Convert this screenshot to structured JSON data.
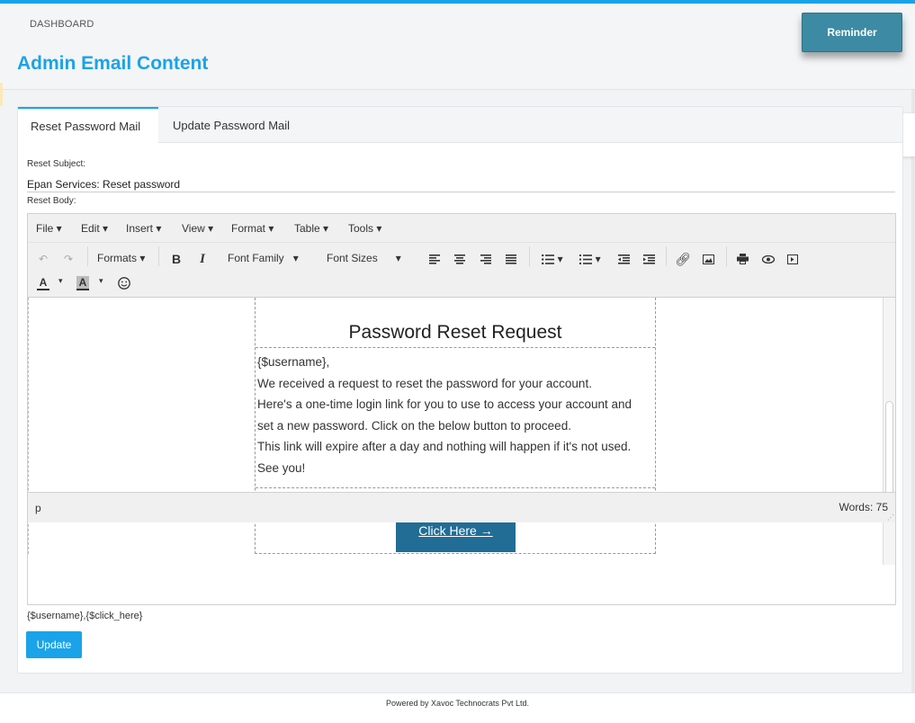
{
  "header": {
    "breadcrumb": "DASHBOARD",
    "title": "Admin Email Content",
    "reminder_label": "Reminder"
  },
  "tabs": [
    {
      "label": "Reset Password Mail",
      "active": true
    },
    {
      "label": "Update Password Mail",
      "active": false
    }
  ],
  "form": {
    "subject_label": "Reset Subject:",
    "subject_value": "Epan Services: Reset password",
    "body_label": "Reset Body:"
  },
  "editor": {
    "menu": [
      "File",
      "Edit",
      "Insert",
      "View",
      "Format",
      "Table",
      "Tools"
    ],
    "toolbar": {
      "formats": "Formats",
      "font_family": "Font Family",
      "font_sizes": "Font Sizes"
    },
    "status_path": "p",
    "word_count": "Words: 75"
  },
  "email": {
    "title": "Password Reset Request",
    "lines": [
      "{$username},",
      "We received a request to reset the password for your account.",
      "Here's a one-time login link for you to use to access your account and",
      "set a new password. Click on the below button to proceed.",
      "This link will expire after a day and nothing will happen if it's not used.",
      "See you!"
    ],
    "button_label": "Click Here →"
  },
  "placeholders": "{$username},{$click_here}",
  "update_label": "Update",
  "footer": "Powered by Xavoc Technocrats Pvt Ltd.",
  "colors": {
    "accent": "#1aa3e8",
    "reminder": "#3c8aa3",
    "email_button": "#216d96"
  },
  "icons": [
    "gear-icon",
    "undo-icon",
    "redo-icon",
    "bold-icon",
    "italic-icon",
    "align-left-icon",
    "align-center-icon",
    "align-right-icon",
    "align-justify-icon",
    "bullet-list-icon",
    "numbered-list-icon",
    "outdent-icon",
    "indent-icon",
    "link-icon",
    "image-icon",
    "print-icon",
    "preview-icon",
    "media-icon",
    "text-color-icon",
    "background-color-icon",
    "emoticon-icon"
  ]
}
